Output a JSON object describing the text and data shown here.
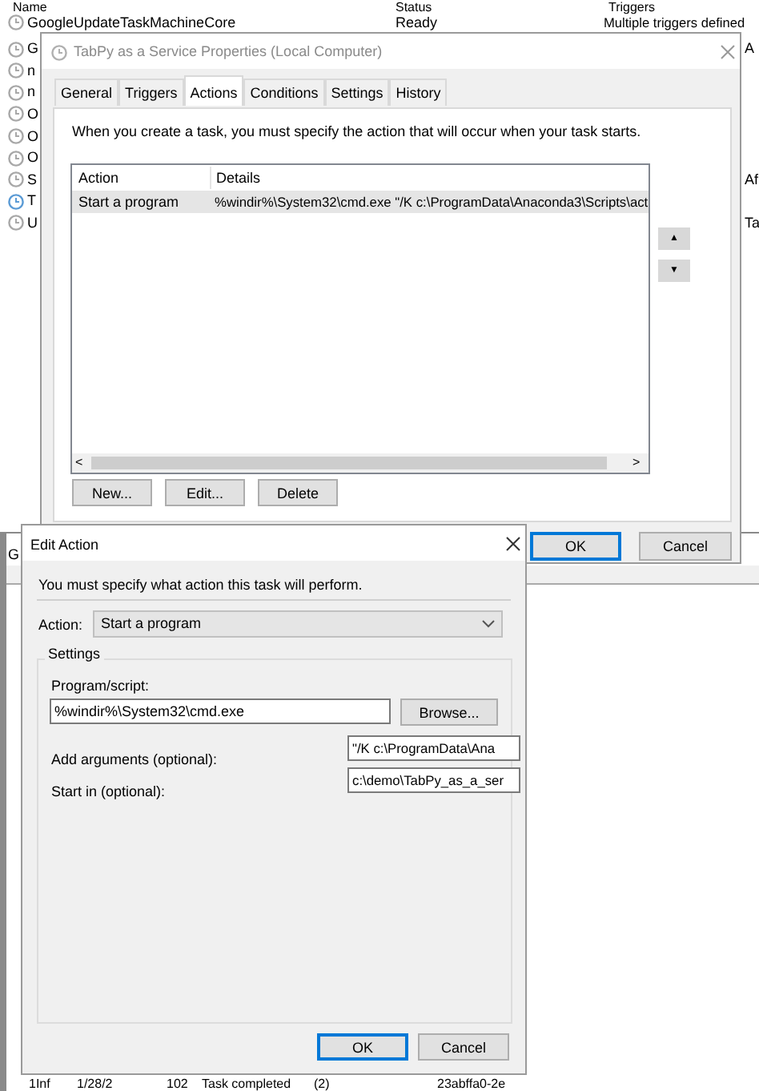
{
  "task_list": {
    "columns": [
      "Name",
      "Status",
      "Triggers"
    ],
    "rows": [
      {
        "name": "GoogleUpdateTaskMachineCore",
        "status": "Ready",
        "triggers": "Multiple triggers defined",
        "color": "#a8a8a8"
      },
      {
        "name": "G",
        "side": "A",
        "color": "#a8a8a8"
      },
      {
        "name": "n",
        "color": "#a8a8a8"
      },
      {
        "name": "n",
        "color": "#a8a8a8"
      },
      {
        "name": "O",
        "color": "#a8a8a8"
      },
      {
        "name": "O",
        "color": "#a8a8a8"
      },
      {
        "name": "O",
        "color": "#a8a8a8"
      },
      {
        "name": "S",
        "side": "Af",
        "color": "#a8a8a8"
      },
      {
        "name": "T",
        "color": "#5b9bd5"
      },
      {
        "name": "U",
        "side": "Ta",
        "color": "#a8a8a8"
      }
    ]
  },
  "history_pane": {
    "label": "G",
    "row": [
      "1Inf",
      "1/28/2",
      "102",
      "Task completed",
      "(2)",
      "23abffa0-2e"
    ]
  },
  "properties": {
    "title": "TabPy as a Service Properties (Local Computer)",
    "tabs": [
      {
        "label": "General",
        "selected": false
      },
      {
        "label": "Triggers",
        "selected": false
      },
      {
        "label": "Actions",
        "selected": true
      },
      {
        "label": "Conditions",
        "selected": false
      },
      {
        "label": "Settings",
        "selected": false
      },
      {
        "label": "History",
        "selected": false
      }
    ],
    "intro": "When you create a task, you must specify the action that will occur when your task starts.",
    "columns": [
      "Action",
      "Details"
    ],
    "rows": [
      {
        "action": "Start a program",
        "details": "%windir%\\System32\\cmd.exe \"/K c:\\ProgramData\\Anaconda3\\Scripts\\act",
        "selected": true
      }
    ],
    "scroll_glyphs": [
      "<",
      ">"
    ],
    "move_glyphs": [
      "▲",
      "▼"
    ],
    "list_buttons": [
      "New...",
      "Edit...",
      "Delete"
    ],
    "ok": "OK",
    "cancel": "Cancel"
  },
  "edit_action": {
    "title": "Edit Action",
    "intro": "You must specify what action this task will perform.",
    "action_label": "Action:",
    "action_value": "Start a program",
    "settings_label": "Settings",
    "program_label": "Program/script:",
    "program_value": "%windir%\\System32\\cmd.exe",
    "browse": "Browse...",
    "args_label": "Add arguments (optional):",
    "args_value": "\"/K c:\\ProgramData\\Ana",
    "start_label": "Start in (optional):",
    "start_value": "c:\\demo\\TabPy_as_a_ser",
    "ok": "OK",
    "cancel": "Cancel"
  }
}
